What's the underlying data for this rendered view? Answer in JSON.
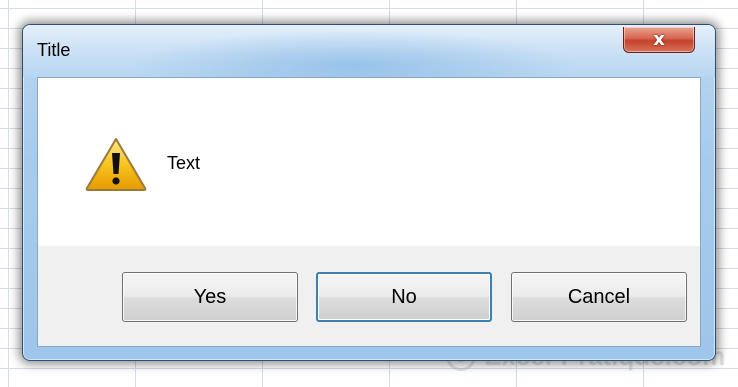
{
  "dialog": {
    "title": "Title",
    "close_icon": "close-icon",
    "close_glyph": "x",
    "message": "Text",
    "message_icon": "warning-icon",
    "buttons": [
      {
        "label": "Yes"
      },
      {
        "label": "No",
        "focused": true
      },
      {
        "label": "Cancel"
      }
    ]
  },
  "background": {
    "watermark": "Excel-Pratique.com",
    "watermark_symbol": "©"
  },
  "colors": {
    "titlebar": "#b9d8f2",
    "close_button": "#c5402a",
    "focus_border": "#3c7fb1",
    "button_bar": "#f0f0f0"
  }
}
